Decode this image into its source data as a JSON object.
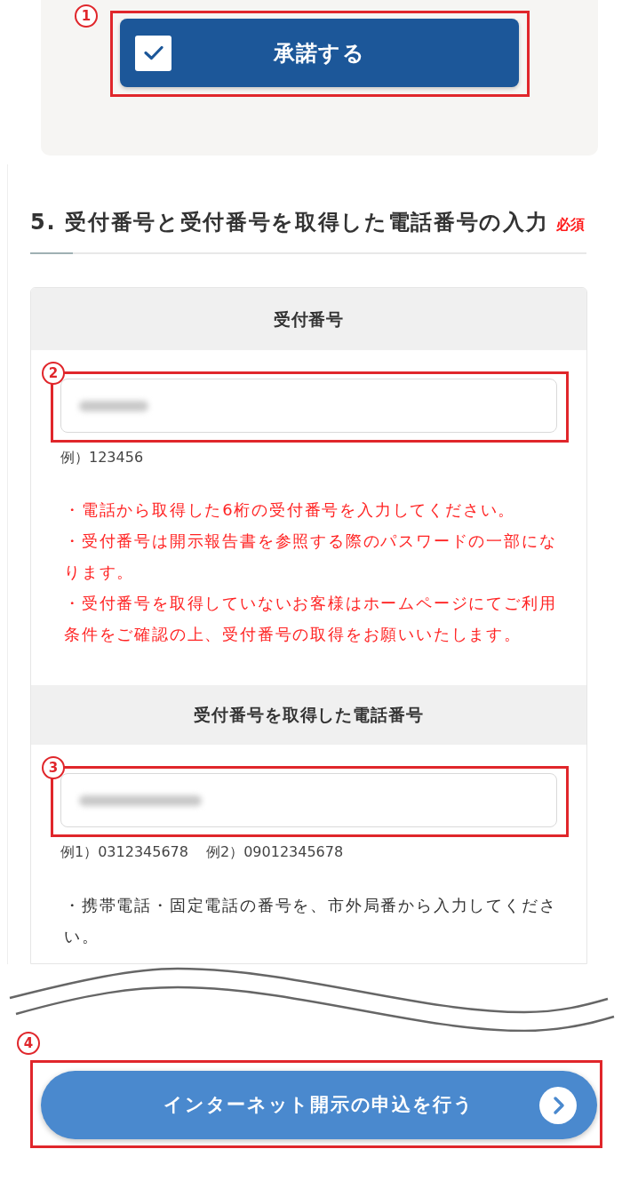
{
  "consent_button": {
    "callout": "1",
    "label": "承諾する",
    "checked": true
  },
  "section": {
    "title": "5. 受付番号と受付番号を取得した電話番号の入力",
    "required_badge": "必須"
  },
  "fields": [
    {
      "heading": "受付番号",
      "callout": "2",
      "value_blurred": true,
      "examples": [
        "例）123456"
      ],
      "notes": [
        {
          "kind": "warning",
          "text": "・電話から取得した6桁の受付番号を入力してください。"
        },
        {
          "kind": "warning",
          "text": "・受付番号は開示報告書を参照する際のパスワードの一部になります。"
        },
        {
          "kind": "warning",
          "text": "・受付番号を取得していないお客様はホームページにてご利用条件をご確認の上、受付番号の取得をお願いいたします。"
        }
      ]
    },
    {
      "heading": "受付番号を取得した電話番号",
      "callout": "3",
      "value_blurred": true,
      "examples": [
        "例1）0312345678",
        "例2）09012345678"
      ],
      "notes": [
        {
          "kind": "plain",
          "text": "・携帯電話・固定電話の番号を、市外局番から入力してください。"
        }
      ]
    }
  ],
  "submit_button": {
    "callout": "4",
    "label": "インターネット開示の申込を行う"
  }
}
